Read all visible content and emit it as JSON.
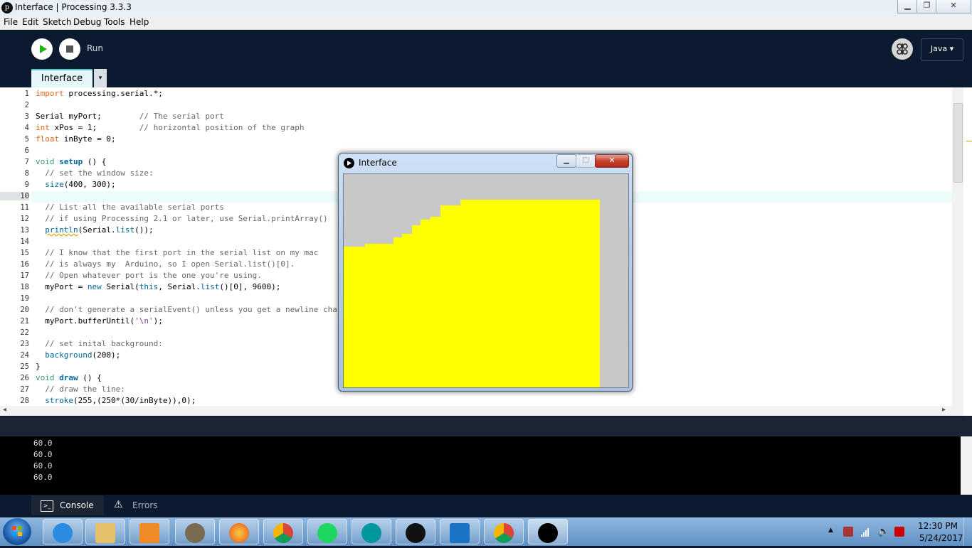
{
  "window": {
    "title": "Interface | Processing 3.3.3"
  },
  "menu": [
    "File",
    "Edit",
    "Sketch",
    "Debug",
    "Tools",
    "Help"
  ],
  "toolbar": {
    "run_label": "Run",
    "mode_label": "Java ▾"
  },
  "tabs": {
    "active": "Interface",
    "menu_arrow": "▾"
  },
  "editor": {
    "line_numbers": [
      "1",
      "2",
      "3",
      "4",
      "5",
      "6",
      "7",
      "8",
      "9",
      "10",
      "11",
      "12",
      "13",
      "14",
      "15",
      "16",
      "17",
      "18",
      "19",
      "20",
      "21",
      "22",
      "23",
      "24",
      "25",
      "26",
      "27",
      "28"
    ]
  },
  "code": {
    "l1_kw": "import",
    "l1_rest": " processing.serial.*;",
    "l3": "Serial myPort;        ",
    "l3_cm": "// The serial port",
    "l4_kw": "int",
    "l4_rest": " xPos = 1;         ",
    "l4_cm": "// horizontal position of the graph",
    "l5_kw": "float",
    "l5_rest": " inByte = 0;",
    "l7_kw": "void",
    "l7_fn": "setup",
    "l7_rest": " () {",
    "l8": "  // set the window size:",
    "l9_fn": "size",
    "l9_rest": "(400, 300);",
    "l11": "  // List all the available serial ports",
    "l12": "  // if using Processing 2.1 or later, use Serial.printArray()",
    "l13_fn": "println",
    "l13_a": "(Serial.",
    "l13_fn2": "list",
    "l13_b": "());",
    "l15": "  // I know that the first port in the serial list on my mac",
    "l16": "  // is always my  Arduino, so I open Serial.list()[0].",
    "l17": "  // Open whatever port is the one you're using.",
    "l18_a": "  myPort = ",
    "l18_kw": "new",
    "l18_b": " Serial(",
    "l18_kw2": "this",
    "l18_c": ", Serial.",
    "l18_fn": "list",
    "l18_d": "()[0], 9600);",
    "l20": "  // don't generate a serialEvent() unless you get a newline character:",
    "l21_a": "  myPort.bufferUntil(",
    "l21_str": "'\\n'",
    "l21_b": ");",
    "l23": "  // set inital background:",
    "l24_fn": "background",
    "l24_rest": "(200);",
    "l25": "}",
    "l26_kw": "void",
    "l26_fn": "draw",
    "l26_rest": " () {",
    "l27": "  // draw the line:",
    "l28_fn": "stroke",
    "l28_rest": "(255,(250*(30/inByte)),0);"
  },
  "console": {
    "lines": [
      "60.0",
      "60.0",
      "60.0",
      "60.0"
    ],
    "console_tab": "Console",
    "errors_tab": "Errors"
  },
  "sketch_window": {
    "title": "Interface",
    "bar_color": "#ffff00",
    "background": "#c8c8c8"
  },
  "taskbar": {
    "time": "12:30 PM",
    "date": "5/24/2017"
  },
  "colors": {
    "ide_dark": "#0b1a2e",
    "accent": "#49c9d5",
    "run_green": "#1db313"
  }
}
